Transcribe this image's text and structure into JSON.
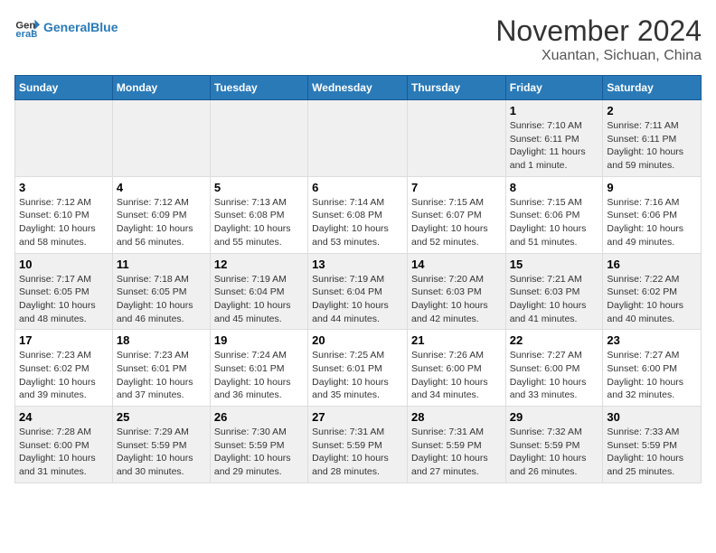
{
  "header": {
    "logo_line1": "General",
    "logo_line2": "Blue",
    "month": "November 2024",
    "location": "Xuantan, Sichuan, China"
  },
  "weekdays": [
    "Sunday",
    "Monday",
    "Tuesday",
    "Wednesday",
    "Thursday",
    "Friday",
    "Saturday"
  ],
  "weeks": [
    [
      {
        "day": "",
        "info": ""
      },
      {
        "day": "",
        "info": ""
      },
      {
        "day": "",
        "info": ""
      },
      {
        "day": "",
        "info": ""
      },
      {
        "day": "",
        "info": ""
      },
      {
        "day": "1",
        "info": "Sunrise: 7:10 AM\nSunset: 6:11 PM\nDaylight: 11 hours and 1 minute."
      },
      {
        "day": "2",
        "info": "Sunrise: 7:11 AM\nSunset: 6:11 PM\nDaylight: 10 hours and 59 minutes."
      }
    ],
    [
      {
        "day": "3",
        "info": "Sunrise: 7:12 AM\nSunset: 6:10 PM\nDaylight: 10 hours and 58 minutes."
      },
      {
        "day": "4",
        "info": "Sunrise: 7:12 AM\nSunset: 6:09 PM\nDaylight: 10 hours and 56 minutes."
      },
      {
        "day": "5",
        "info": "Sunrise: 7:13 AM\nSunset: 6:08 PM\nDaylight: 10 hours and 55 minutes."
      },
      {
        "day": "6",
        "info": "Sunrise: 7:14 AM\nSunset: 6:08 PM\nDaylight: 10 hours and 53 minutes."
      },
      {
        "day": "7",
        "info": "Sunrise: 7:15 AM\nSunset: 6:07 PM\nDaylight: 10 hours and 52 minutes."
      },
      {
        "day": "8",
        "info": "Sunrise: 7:15 AM\nSunset: 6:06 PM\nDaylight: 10 hours and 51 minutes."
      },
      {
        "day": "9",
        "info": "Sunrise: 7:16 AM\nSunset: 6:06 PM\nDaylight: 10 hours and 49 minutes."
      }
    ],
    [
      {
        "day": "10",
        "info": "Sunrise: 7:17 AM\nSunset: 6:05 PM\nDaylight: 10 hours and 48 minutes."
      },
      {
        "day": "11",
        "info": "Sunrise: 7:18 AM\nSunset: 6:05 PM\nDaylight: 10 hours and 46 minutes."
      },
      {
        "day": "12",
        "info": "Sunrise: 7:19 AM\nSunset: 6:04 PM\nDaylight: 10 hours and 45 minutes."
      },
      {
        "day": "13",
        "info": "Sunrise: 7:19 AM\nSunset: 6:04 PM\nDaylight: 10 hours and 44 minutes."
      },
      {
        "day": "14",
        "info": "Sunrise: 7:20 AM\nSunset: 6:03 PM\nDaylight: 10 hours and 42 minutes."
      },
      {
        "day": "15",
        "info": "Sunrise: 7:21 AM\nSunset: 6:03 PM\nDaylight: 10 hours and 41 minutes."
      },
      {
        "day": "16",
        "info": "Sunrise: 7:22 AM\nSunset: 6:02 PM\nDaylight: 10 hours and 40 minutes."
      }
    ],
    [
      {
        "day": "17",
        "info": "Sunrise: 7:23 AM\nSunset: 6:02 PM\nDaylight: 10 hours and 39 minutes."
      },
      {
        "day": "18",
        "info": "Sunrise: 7:23 AM\nSunset: 6:01 PM\nDaylight: 10 hours and 37 minutes."
      },
      {
        "day": "19",
        "info": "Sunrise: 7:24 AM\nSunset: 6:01 PM\nDaylight: 10 hours and 36 minutes."
      },
      {
        "day": "20",
        "info": "Sunrise: 7:25 AM\nSunset: 6:01 PM\nDaylight: 10 hours and 35 minutes."
      },
      {
        "day": "21",
        "info": "Sunrise: 7:26 AM\nSunset: 6:00 PM\nDaylight: 10 hours and 34 minutes."
      },
      {
        "day": "22",
        "info": "Sunrise: 7:27 AM\nSunset: 6:00 PM\nDaylight: 10 hours and 33 minutes."
      },
      {
        "day": "23",
        "info": "Sunrise: 7:27 AM\nSunset: 6:00 PM\nDaylight: 10 hours and 32 minutes."
      }
    ],
    [
      {
        "day": "24",
        "info": "Sunrise: 7:28 AM\nSunset: 6:00 PM\nDaylight: 10 hours and 31 minutes."
      },
      {
        "day": "25",
        "info": "Sunrise: 7:29 AM\nSunset: 5:59 PM\nDaylight: 10 hours and 30 minutes."
      },
      {
        "day": "26",
        "info": "Sunrise: 7:30 AM\nSunset: 5:59 PM\nDaylight: 10 hours and 29 minutes."
      },
      {
        "day": "27",
        "info": "Sunrise: 7:31 AM\nSunset: 5:59 PM\nDaylight: 10 hours and 28 minutes."
      },
      {
        "day": "28",
        "info": "Sunrise: 7:31 AM\nSunset: 5:59 PM\nDaylight: 10 hours and 27 minutes."
      },
      {
        "day": "29",
        "info": "Sunrise: 7:32 AM\nSunset: 5:59 PM\nDaylight: 10 hours and 26 minutes."
      },
      {
        "day": "30",
        "info": "Sunrise: 7:33 AM\nSunset: 5:59 PM\nDaylight: 10 hours and 25 minutes."
      }
    ]
  ]
}
